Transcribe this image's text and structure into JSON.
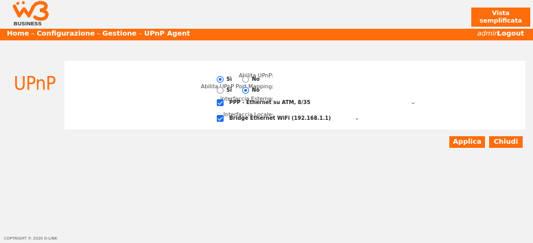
{
  "header": {
    "brand_text": "BUSINESS",
    "vista_button": "Vista semplificata"
  },
  "nav": {
    "breadcrumb": [
      "Home",
      "Configurazione",
      "Gestione",
      "UPnP Agent"
    ],
    "separator": "–",
    "user": "admin",
    "logout": "Logout"
  },
  "page": {
    "heading": "UPnP"
  },
  "form": {
    "enable_upnp": {
      "label": "Abilita UPnP:",
      "options": [
        "Sì",
        "No"
      ],
      "selected": "Sì"
    },
    "port_mapping": {
      "label": "Abilita UPnP Port Mapping:",
      "options": [
        "Sì",
        "No"
      ],
      "selected": "No"
    },
    "external_interface": {
      "label": "Interfaccia Esterna:",
      "value": "PPP - Ethernet su ATM, 8/35",
      "checked": true
    },
    "local_interface": {
      "label": "Interfaccia Locale:",
      "value": "Bridge Ethernet WiFi (192.168.1.1)",
      "checked": true
    }
  },
  "actions": {
    "apply": "Applica",
    "close": "Chiudi"
  },
  "footer": {
    "copyright": "COPYRIGHT © 2020 D-LINK"
  },
  "colors": {
    "accent": "#ff6d0c",
    "control_blue": "#1b6ee8",
    "background": "#f2f2f2"
  }
}
